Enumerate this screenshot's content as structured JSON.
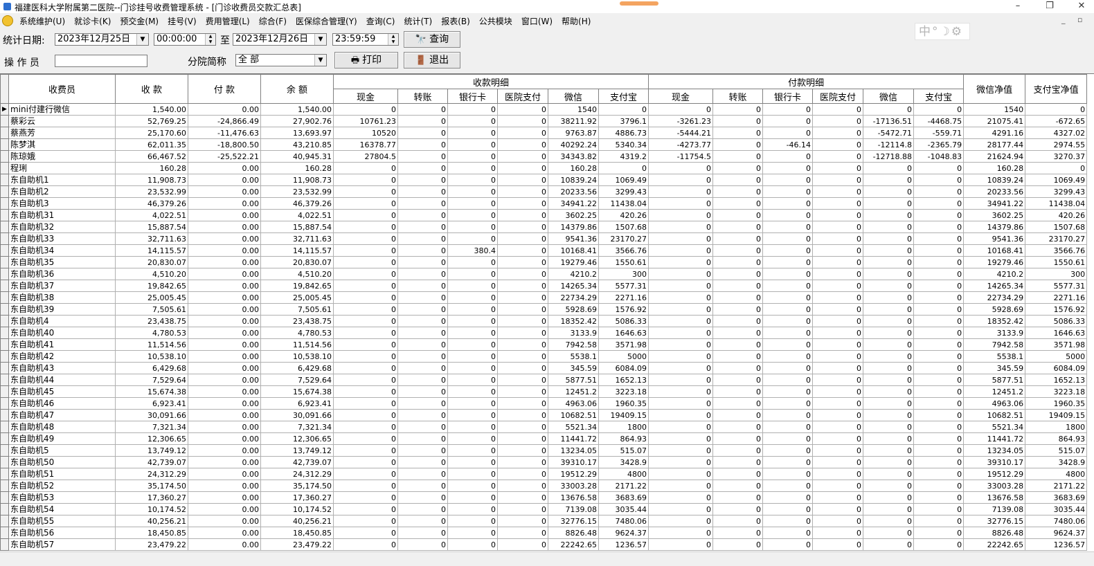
{
  "window": {
    "title": "福建医科大学附属第二医院--门诊挂号收费管理系统 - [门诊收费员交款汇总表]",
    "minimize": "–",
    "restore": "❐",
    "close": "✕"
  },
  "menu": {
    "items": [
      "系统维护(U)",
      "就诊卡(K)",
      "预交金(M)",
      "挂号(V)",
      "费用管理(L)",
      "综合(F)",
      "医保综合管理(Y)",
      "查询(C)",
      "统计(T)",
      "报表(B)",
      "公共模块",
      "窗口(W)",
      "帮助(H)"
    ],
    "mdi_minimize": "_",
    "mdi_restore": "▫"
  },
  "toolbar": {
    "date_label": "统计日期:",
    "date_from": "2023年12月25日",
    "time_from": "00:00:00",
    "to_label": "至",
    "date_to": "2023年12月26日",
    "time_to": "23:59:59",
    "query_button": "查询",
    "operator_label": "操 作 员",
    "operator_value": "",
    "branch_label": "分院简称",
    "branch_value": "全 部",
    "print_button": "打印",
    "exit_button": "退出"
  },
  "ime": {
    "text": "中°☽⚙"
  },
  "table": {
    "headers": {
      "cashier": "收费员",
      "received": "收  款",
      "paid": "付  款",
      "balance": "余  额",
      "receipt_detail": "收款明细",
      "payment_detail": "付款明细",
      "wechat_net": "微信净值",
      "alipay_net": "支付宝净值",
      "sub": [
        "现金",
        "转账",
        "银行卡",
        "医院支付",
        "微信",
        "支付宝"
      ]
    },
    "rows": [
      [
        "mini付建行微信",
        "1,540.00",
        "0.00",
        "1,540.00",
        "0",
        "0",
        "0",
        "0",
        "1540",
        "0",
        "0",
        "0",
        "0",
        "0",
        "0",
        "0",
        "1540",
        "0"
      ],
      [
        "蔡彩云",
        "52,769.25",
        "-24,866.49",
        "27,902.76",
        "10761.23",
        "0",
        "0",
        "0",
        "38211.92",
        "3796.1",
        "-3261.23",
        "0",
        "0",
        "0",
        "-17136.51",
        "-4468.75",
        "21075.41",
        "-672.65"
      ],
      [
        "蔡燕芳",
        "25,170.60",
        "-11,476.63",
        "13,693.97",
        "10520",
        "0",
        "0",
        "0",
        "9763.87",
        "4886.73",
        "-5444.21",
        "0",
        "0",
        "0",
        "-5472.71",
        "-559.71",
        "4291.16",
        "4327.02"
      ],
      [
        "陈梦淇",
        "62,011.35",
        "-18,800.50",
        "43,210.85",
        "16378.77",
        "0",
        "0",
        "0",
        "40292.24",
        "5340.34",
        "-4273.77",
        "0",
        "-46.14",
        "0",
        "-12114.8",
        "-2365.79",
        "28177.44",
        "2974.55"
      ],
      [
        "陈琼娥",
        "66,467.52",
        "-25,522.21",
        "40,945.31",
        "27804.5",
        "0",
        "0",
        "0",
        "34343.82",
        "4319.2",
        "-11754.5",
        "0",
        "0",
        "0",
        "-12718.88",
        "-1048.83",
        "21624.94",
        "3270.37"
      ],
      [
        "程琍",
        "160.28",
        "0.00",
        "160.28",
        "0",
        "0",
        "0",
        "0",
        "160.28",
        "0",
        "0",
        "0",
        "0",
        "0",
        "0",
        "0",
        "160.28",
        "0"
      ],
      [
        "东自助机1",
        "11,908.73",
        "0.00",
        "11,908.73",
        "0",
        "0",
        "0",
        "0",
        "10839.24",
        "1069.49",
        "0",
        "0",
        "0",
        "0",
        "0",
        "0",
        "10839.24",
        "1069.49"
      ],
      [
        "东自助机2",
        "23,532.99",
        "0.00",
        "23,532.99",
        "0",
        "0",
        "0",
        "0",
        "20233.56",
        "3299.43",
        "0",
        "0",
        "0",
        "0",
        "0",
        "0",
        "20233.56",
        "3299.43"
      ],
      [
        "东自助机3",
        "46,379.26",
        "0.00",
        "46,379.26",
        "0",
        "0",
        "0",
        "0",
        "34941.22",
        "11438.04",
        "0",
        "0",
        "0",
        "0",
        "0",
        "0",
        "34941.22",
        "11438.04"
      ],
      [
        "东自助机31",
        "4,022.51",
        "0.00",
        "4,022.51",
        "0",
        "0",
        "0",
        "0",
        "3602.25",
        "420.26",
        "0",
        "0",
        "0",
        "0",
        "0",
        "0",
        "3602.25",
        "420.26"
      ],
      [
        "东自助机32",
        "15,887.54",
        "0.00",
        "15,887.54",
        "0",
        "0",
        "0",
        "0",
        "14379.86",
        "1507.68",
        "0",
        "0",
        "0",
        "0",
        "0",
        "0",
        "14379.86",
        "1507.68"
      ],
      [
        "东自助机33",
        "32,711.63",
        "0.00",
        "32,711.63",
        "0",
        "0",
        "0",
        "0",
        "9541.36",
        "23170.27",
        "0",
        "0",
        "0",
        "0",
        "0",
        "0",
        "9541.36",
        "23170.27"
      ],
      [
        "东自助机34",
        "14,115.57",
        "0.00",
        "14,115.57",
        "0",
        "0",
        "380.4",
        "0",
        "10168.41",
        "3566.76",
        "0",
        "0",
        "0",
        "0",
        "0",
        "0",
        "10168.41",
        "3566.76"
      ],
      [
        "东自助机35",
        "20,830.07",
        "0.00",
        "20,830.07",
        "0",
        "0",
        "0",
        "0",
        "19279.46",
        "1550.61",
        "0",
        "0",
        "0",
        "0",
        "0",
        "0",
        "19279.46",
        "1550.61"
      ],
      [
        "东自助机36",
        "4,510.20",
        "0.00",
        "4,510.20",
        "0",
        "0",
        "0",
        "0",
        "4210.2",
        "300",
        "0",
        "0",
        "0",
        "0",
        "0",
        "0",
        "4210.2",
        "300"
      ],
      [
        "东自助机37",
        "19,842.65",
        "0.00",
        "19,842.65",
        "0",
        "0",
        "0",
        "0",
        "14265.34",
        "5577.31",
        "0",
        "0",
        "0",
        "0",
        "0",
        "0",
        "14265.34",
        "5577.31"
      ],
      [
        "东自助机38",
        "25,005.45",
        "0.00",
        "25,005.45",
        "0",
        "0",
        "0",
        "0",
        "22734.29",
        "2271.16",
        "0",
        "0",
        "0",
        "0",
        "0",
        "0",
        "22734.29",
        "2271.16"
      ],
      [
        "东自助机39",
        "7,505.61",
        "0.00",
        "7,505.61",
        "0",
        "0",
        "0",
        "0",
        "5928.69",
        "1576.92",
        "0",
        "0",
        "0",
        "0",
        "0",
        "0",
        "5928.69",
        "1576.92"
      ],
      [
        "东自助机4",
        "23,438.75",
        "0.00",
        "23,438.75",
        "0",
        "0",
        "0",
        "0",
        "18352.42",
        "5086.33",
        "0",
        "0",
        "0",
        "0",
        "0",
        "0",
        "18352.42",
        "5086.33"
      ],
      [
        "东自助机40",
        "4,780.53",
        "0.00",
        "4,780.53",
        "0",
        "0",
        "0",
        "0",
        "3133.9",
        "1646.63",
        "0",
        "0",
        "0",
        "0",
        "0",
        "0",
        "3133.9",
        "1646.63"
      ],
      [
        "东自助机41",
        "11,514.56",
        "0.00",
        "11,514.56",
        "0",
        "0",
        "0",
        "0",
        "7942.58",
        "3571.98",
        "0",
        "0",
        "0",
        "0",
        "0",
        "0",
        "7942.58",
        "3571.98"
      ],
      [
        "东自助机42",
        "10,538.10",
        "0.00",
        "10,538.10",
        "0",
        "0",
        "0",
        "0",
        "5538.1",
        "5000",
        "0",
        "0",
        "0",
        "0",
        "0",
        "0",
        "5538.1",
        "5000"
      ],
      [
        "东自助机43",
        "6,429.68",
        "0.00",
        "6,429.68",
        "0",
        "0",
        "0",
        "0",
        "345.59",
        "6084.09",
        "0",
        "0",
        "0",
        "0",
        "0",
        "0",
        "345.59",
        "6084.09"
      ],
      [
        "东自助机44",
        "7,529.64",
        "0.00",
        "7,529.64",
        "0",
        "0",
        "0",
        "0",
        "5877.51",
        "1652.13",
        "0",
        "0",
        "0",
        "0",
        "0",
        "0",
        "5877.51",
        "1652.13"
      ],
      [
        "东自助机45",
        "15,674.38",
        "0.00",
        "15,674.38",
        "0",
        "0",
        "0",
        "0",
        "12451.2",
        "3223.18",
        "0",
        "0",
        "0",
        "0",
        "0",
        "0",
        "12451.2",
        "3223.18"
      ],
      [
        "东自助机46",
        "6,923.41",
        "0.00",
        "6,923.41",
        "0",
        "0",
        "0",
        "0",
        "4963.06",
        "1960.35",
        "0",
        "0",
        "0",
        "0",
        "0",
        "0",
        "4963.06",
        "1960.35"
      ],
      [
        "东自助机47",
        "30,091.66",
        "0.00",
        "30,091.66",
        "0",
        "0",
        "0",
        "0",
        "10682.51",
        "19409.15",
        "0",
        "0",
        "0",
        "0",
        "0",
        "0",
        "10682.51",
        "19409.15"
      ],
      [
        "东自助机48",
        "7,321.34",
        "0.00",
        "7,321.34",
        "0",
        "0",
        "0",
        "0",
        "5521.34",
        "1800",
        "0",
        "0",
        "0",
        "0",
        "0",
        "0",
        "5521.34",
        "1800"
      ],
      [
        "东自助机49",
        "12,306.65",
        "0.00",
        "12,306.65",
        "0",
        "0",
        "0",
        "0",
        "11441.72",
        "864.93",
        "0",
        "0",
        "0",
        "0",
        "0",
        "0",
        "11441.72",
        "864.93"
      ],
      [
        "东自助机5",
        "13,749.12",
        "0.00",
        "13,749.12",
        "0",
        "0",
        "0",
        "0",
        "13234.05",
        "515.07",
        "0",
        "0",
        "0",
        "0",
        "0",
        "0",
        "13234.05",
        "515.07"
      ],
      [
        "东自助机50",
        "42,739.07",
        "0.00",
        "42,739.07",
        "0",
        "0",
        "0",
        "0",
        "39310.17",
        "3428.9",
        "0",
        "0",
        "0",
        "0",
        "0",
        "0",
        "39310.17",
        "3428.9"
      ],
      [
        "东自助机51",
        "24,312.29",
        "0.00",
        "24,312.29",
        "0",
        "0",
        "0",
        "0",
        "19512.29",
        "4800",
        "0",
        "0",
        "0",
        "0",
        "0",
        "0",
        "19512.29",
        "4800"
      ],
      [
        "东自助机52",
        "35,174.50",
        "0.00",
        "35,174.50",
        "0",
        "0",
        "0",
        "0",
        "33003.28",
        "2171.22",
        "0",
        "0",
        "0",
        "0",
        "0",
        "0",
        "33003.28",
        "2171.22"
      ],
      [
        "东自助机53",
        "17,360.27",
        "0.00",
        "17,360.27",
        "0",
        "0",
        "0",
        "0",
        "13676.58",
        "3683.69",
        "0",
        "0",
        "0",
        "0",
        "0",
        "0",
        "13676.58",
        "3683.69"
      ],
      [
        "东自助机54",
        "10,174.52",
        "0.00",
        "10,174.52",
        "0",
        "0",
        "0",
        "0",
        "7139.08",
        "3035.44",
        "0",
        "0",
        "0",
        "0",
        "0",
        "0",
        "7139.08",
        "3035.44"
      ],
      [
        "东自助机55",
        "40,256.21",
        "0.00",
        "40,256.21",
        "0",
        "0",
        "0",
        "0",
        "32776.15",
        "7480.06",
        "0",
        "0",
        "0",
        "0",
        "0",
        "0",
        "32776.15",
        "7480.06"
      ],
      [
        "东自助机56",
        "18,450.85",
        "0.00",
        "18,450.85",
        "0",
        "0",
        "0",
        "0",
        "8826.48",
        "9624.37",
        "0",
        "0",
        "0",
        "0",
        "0",
        "0",
        "8826.48",
        "9624.37"
      ],
      [
        "东自助机57",
        "23,479.22",
        "0.00",
        "23,479.22",
        "0",
        "0",
        "0",
        "0",
        "22242.65",
        "1236.57",
        "0",
        "0",
        "0",
        "0",
        "0",
        "0",
        "22242.65",
        "1236.57"
      ]
    ]
  }
}
